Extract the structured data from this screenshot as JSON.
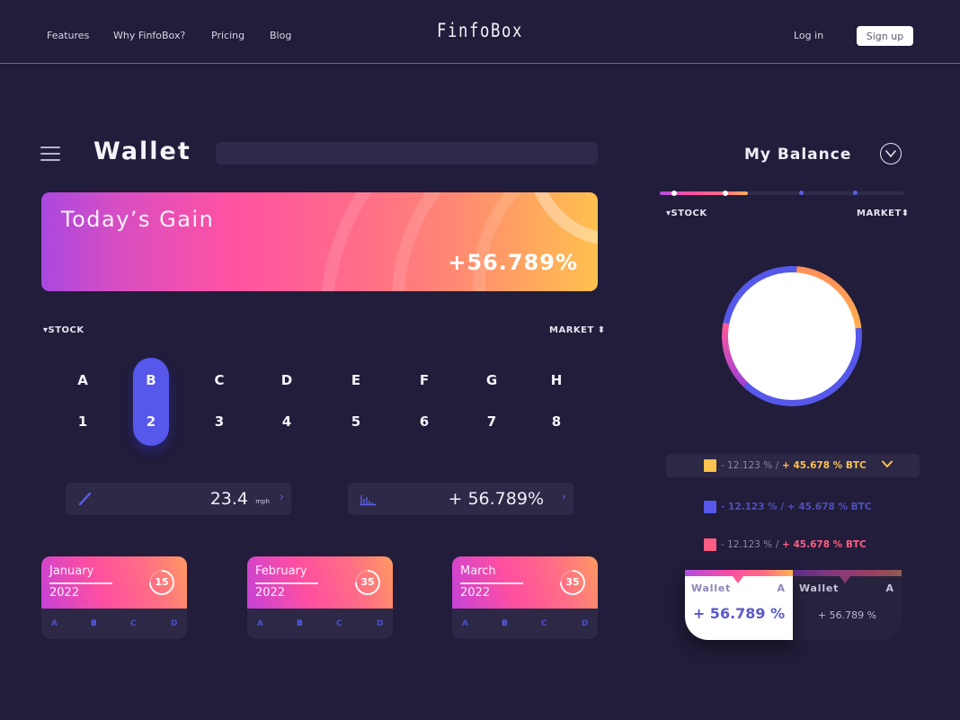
{
  "nav": {
    "links": [
      "Features",
      "Why FinfoBox?",
      "Pricing",
      "Blog"
    ],
    "logo": "FinfoBox",
    "login": "Log in",
    "signup": "Sign up"
  },
  "wallet": {
    "title": "Wallet",
    "search_placeholder": ""
  },
  "gain": {
    "label": "Today’s Gain",
    "value": "+56.789%"
  },
  "selector": {
    "stock_label": "▾STOCK",
    "market_label": "MARKET ⬍",
    "active_index": 1,
    "columns": [
      {
        "letter": "A",
        "number": "1"
      },
      {
        "letter": "B",
        "number": "2"
      },
      {
        "letter": "C",
        "number": "3"
      },
      {
        "letter": "D",
        "number": "4"
      },
      {
        "letter": "E",
        "number": "5"
      },
      {
        "letter": "F",
        "number": "6"
      },
      {
        "letter": "G",
        "number": "7"
      },
      {
        "letter": "H",
        "number": "8"
      }
    ]
  },
  "metrics": [
    {
      "icon": "pencil-icon",
      "value": "23.4",
      "unit": "mph",
      "chevron": "›"
    },
    {
      "icon": "bar-chart-icon",
      "value": "+ 56.789%",
      "chevron": "›"
    }
  ],
  "months": [
    {
      "name": "January",
      "year": "2022",
      "count": "15",
      "progress": 0.75,
      "letters": [
        "A",
        "B",
        "C",
        "D"
      ],
      "highlighted": "B"
    },
    {
      "name": "February",
      "year": "2022",
      "count": "35",
      "progress": 0.75,
      "letters": [
        "A",
        "B",
        "C",
        "D"
      ],
      "highlighted": "B"
    },
    {
      "name": "March",
      "year": "2022",
      "count": "35",
      "progress": 0.75,
      "letters": [
        "A",
        "B",
        "C",
        "D"
      ],
      "highlighted": "B"
    }
  ],
  "balance": {
    "title": "My Balance",
    "toggle_icon": "chevron-down-circle-icon",
    "stock_label": "▾STOCK",
    "market_label": "MARKET⬍",
    "slider": {
      "fill_fraction": 0.36,
      "knob_positions": [
        0.06,
        0.27
      ],
      "marker_positions": [
        0.58,
        0.8
      ]
    },
    "donut": {
      "segments": [
        {
          "name": "orange",
          "fraction": 0.22,
          "color": "#ffa24e"
        },
        {
          "name": "blue-bottom",
          "fraction": 0.39,
          "color": "#5558ea"
        },
        {
          "name": "pink-purple",
          "fraction": 0.16,
          "color": "#d84aa6"
        },
        {
          "name": "blue-top",
          "fraction": 0.23,
          "color": "#5558ea"
        }
      ]
    },
    "legend": [
      {
        "color": "#ffc24e",
        "negative": "- 12.123 %",
        "sep": "/",
        "positive": "+ 45.678 % BTC",
        "pos_color": "#ffc24e",
        "chevron": "⌄"
      },
      {
        "color": "#5558ea",
        "negative": "- 12.123 %",
        "sep": "/",
        "positive": "+ 45.678 % BTC",
        "pos_color": "#5558ea"
      },
      {
        "color": "#ff5c84",
        "negative": "- 12.123 %",
        "sep": "/",
        "positive": "+ 45.678 % BTC",
        "pos_color": "#ff5c84"
      }
    ],
    "wallet_tabs": [
      {
        "label": "Wallet",
        "tag": "A",
        "value": "+ 56.789 %"
      },
      {
        "label": "Wallet",
        "tag": "A",
        "value": "+ 56.789 %"
      }
    ]
  },
  "colors": {
    "background": "#211d3a",
    "accent_blue": "#5558ea",
    "accent_pink": "#ff4fa0",
    "accent_orange": "#ffc04e"
  }
}
